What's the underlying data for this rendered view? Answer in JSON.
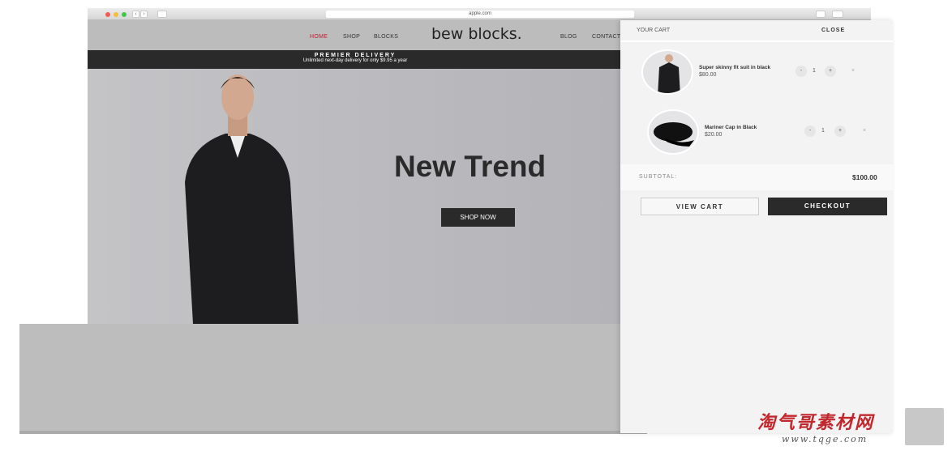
{
  "browser": {
    "url": "apple.com"
  },
  "nav": {
    "items": [
      {
        "label": "HOME",
        "active": true
      },
      {
        "label": "SHOP"
      },
      {
        "label": "BLOCKS"
      },
      {
        "label": "BLOG"
      },
      {
        "label": "CONTACT"
      }
    ],
    "logo": "bew blocks.",
    "active_color": "#b52030"
  },
  "banner": {
    "title": "PREMIER DELIVERY",
    "subtitle": "Unlimited next-day delivery for only $9.95 a year"
  },
  "hero": {
    "title": "New Trend",
    "button": "SHOP NOW"
  },
  "cart": {
    "title": "YOUR CART",
    "close": "CLOSE",
    "items": [
      {
        "name": "Super skinny fit suit in black",
        "price": "$80.00",
        "qty": "1",
        "minus": "-",
        "plus": "+",
        "remove": "×",
        "image": "suit"
      },
      {
        "name": "Mariner Cap in Black",
        "price": "$20.00",
        "qty": "1",
        "minus": "-",
        "plus": "+",
        "remove": "×",
        "image": "cap"
      }
    ],
    "subtotal_label": "SUBTOTAL:",
    "subtotal": "$100.00",
    "view_cart": "VIEW CART",
    "checkout": "CHECKOUT"
  },
  "watermark": {
    "text": "淘气哥素材网",
    "url": "www.tqge.com"
  }
}
